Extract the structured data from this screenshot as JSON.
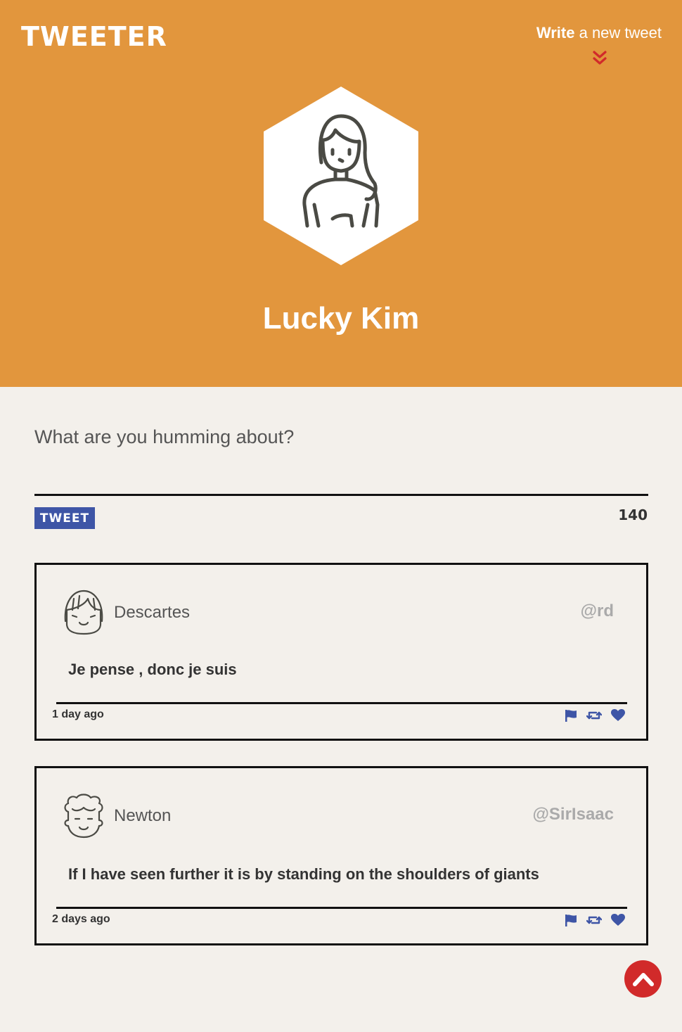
{
  "header": {
    "brand": "TWEETER",
    "compose_toggle": {
      "bold": "Write",
      "rest": " a new tweet"
    },
    "profile_name": "Lucky Kim",
    "background_color": "#e2963d"
  },
  "compose": {
    "placeholder": "What are you humming about?",
    "value": "",
    "button_label": "TWEET",
    "counter": "140"
  },
  "tweets": [
    {
      "author": "Descartes",
      "handle": "@rd",
      "content": "Je pense , donc je suis",
      "time": "1 day ago",
      "avatar_icon": "girl-bangs-avatar-icon"
    },
    {
      "author": "Newton",
      "handle": "@SirIsaac",
      "content": "If I have seen further it is by standing on the shoulders of giants",
      "time": "2 days ago",
      "avatar_icon": "curly-hair-avatar-icon"
    }
  ],
  "icons": {
    "flag": "flag-icon",
    "retweet": "retweet-icon",
    "like": "heart-icon",
    "scroll_top": "chevron-up-icon",
    "compose_toggle": "double-chevron-down-icon"
  },
  "colors": {
    "accent_blue": "#3e55a6",
    "accent_red": "#d12a2a",
    "header_orange": "#e2963d",
    "page_background": "#f3f0eb"
  }
}
